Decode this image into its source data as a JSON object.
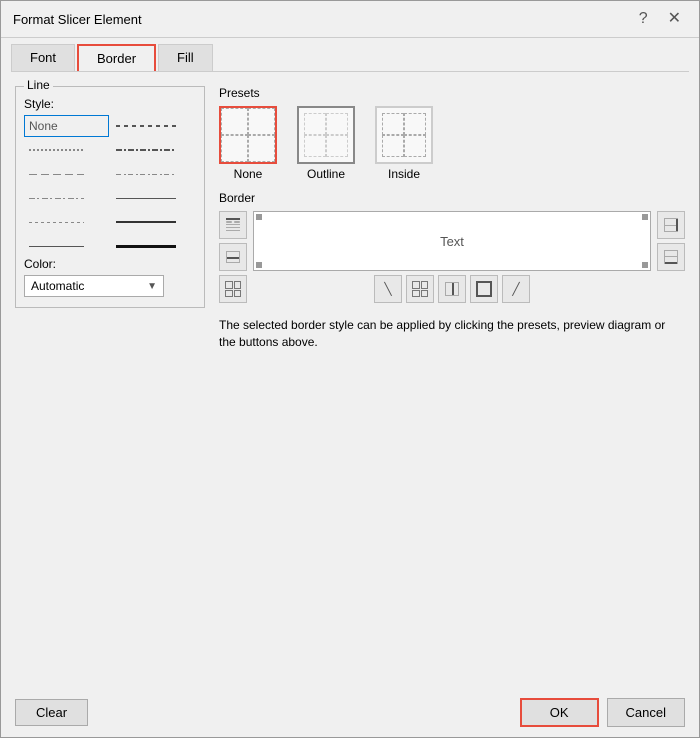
{
  "dialog": {
    "title": "Format Slicer Element",
    "help_btn": "?",
    "close_btn": "✕"
  },
  "tabs": [
    {
      "label": "Font",
      "active": false
    },
    {
      "label": "Border",
      "active": true
    },
    {
      "label": "Fill",
      "active": false
    }
  ],
  "line_section": {
    "label": "Line",
    "style_label": "Style:",
    "style_none": "None",
    "styles": [
      {
        "type": "none",
        "side": "left"
      },
      {
        "type": "dash",
        "side": "right"
      },
      {
        "type": "dotted",
        "side": "left"
      },
      {
        "type": "dash-dot",
        "side": "right"
      },
      {
        "type": "dash2",
        "side": "left"
      },
      {
        "type": "short-dash-dot",
        "side": "right"
      },
      {
        "type": "dash-dot2",
        "side": "left"
      },
      {
        "type": "solid-thin",
        "side": "right"
      },
      {
        "type": "dotted2",
        "side": "left"
      },
      {
        "type": "solid-medium",
        "side": "right"
      },
      {
        "type": "solid",
        "side": "left"
      },
      {
        "type": "solid-thick",
        "side": "right"
      }
    ],
    "color_label": "Color:",
    "color_value": "Automatic"
  },
  "presets_section": {
    "label": "Presets",
    "items": [
      {
        "label": "None",
        "selected": true
      },
      {
        "label": "Outline",
        "selected": false
      },
      {
        "label": "Inside",
        "selected": false
      }
    ]
  },
  "border_section": {
    "label": "Border",
    "preview_text": "Text"
  },
  "info_text": "The selected border style can be applied by clicking the presets, preview diagram or the buttons above.",
  "buttons": {
    "clear": "Clear",
    "ok": "OK",
    "cancel": "Cancel"
  }
}
